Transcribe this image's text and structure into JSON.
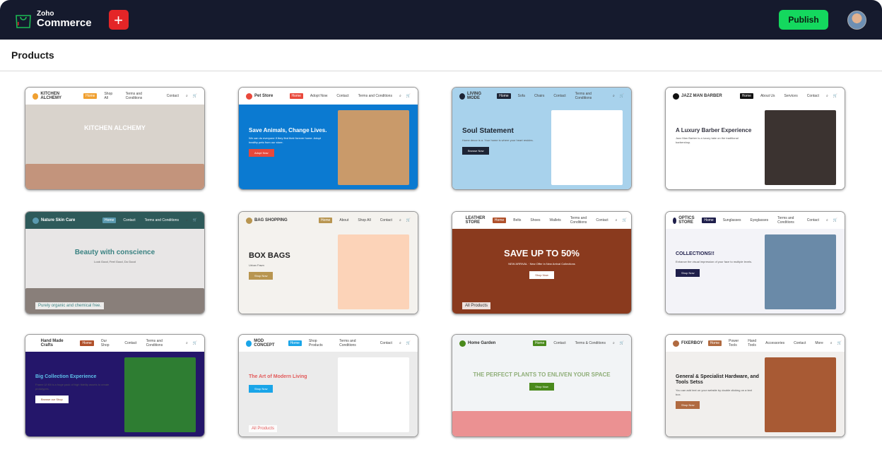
{
  "header": {
    "logo_small": "Zoho",
    "logo_large": "Commerce",
    "add_label": "+",
    "publish_label": "Publish"
  },
  "page_title": "Products",
  "colors": {
    "topbar": "#151a2d",
    "publish": "#14d85e",
    "add": "#e42527"
  },
  "templates": [
    {
      "name": "KITCHEN ALCHEMY",
      "nav": [
        "Home",
        "Shop All",
        "Terms and Conditions",
        "Contact"
      ],
      "headline": "KITCHEN ALCHEMY",
      "sub": "",
      "button": "",
      "header_bg": "#ffffff",
      "hero_bg": "#d9d3cc",
      "hl_color": "#ffffff",
      "accent": "#f0a030",
      "hl_size": 9,
      "center": true,
      "pic": "#b0603a"
    },
    {
      "name": "Pet Store",
      "nav": [
        "Home",
        "Adopt Now",
        "Contact",
        "Terms and Conditions"
      ],
      "headline": "Save Animals, Change Lives.",
      "sub": "We can do everyone if they find their forever home. Adopt healthy pets from our store.",
      "button": "Adopt Now",
      "header_bg": "#ffffff",
      "hero_bg": "#0b7ad1",
      "hl_color": "#ffffff",
      "accent": "#e9483b",
      "hl_size": 8,
      "pic": "#c99a6a"
    },
    {
      "name": "LIVING MODE",
      "nav": [
        "Home",
        "Sofa",
        "Chairs",
        "Contact",
        "Terms and Conditions"
      ],
      "headline": "Soul Statement",
      "sub": "Home decor is a. Your home is where your heart resides.",
      "button": "Browse Now",
      "header_bg": "#a8d2ec",
      "hero_bg": "#a8d2ec",
      "hl_color": "#1d2430",
      "accent": "#1d2435",
      "hl_size": 10,
      "pic": "#ffffff"
    },
    {
      "name": "JAZZ MAN BARBER",
      "nav": [
        "Home",
        "About Us",
        "Services",
        "Contact"
      ],
      "headline": "A Luxury Barber Experience",
      "sub": "Jazz Man Barber is a luxury take on the traditional barbershop.",
      "button": "",
      "header_bg": "#ffffff",
      "hero_bg": "#ffffff",
      "hl_color": "#333340",
      "accent": "#111111",
      "hl_size": 8,
      "pic": "#3b3330"
    },
    {
      "name": "Nature Skin Care",
      "nav": [
        "Home",
        "Contact",
        "Terms and Conditions"
      ],
      "headline": "Beauty with conscience",
      "sub": "Look Good, Feel Good, Do Good",
      "button": "",
      "header_bg": "#2e5a5a",
      "hero_bg": "#e8e6e6",
      "hl_color": "#3a8282",
      "accent": "#5a9ab0",
      "hl_size": 10,
      "center": true,
      "pic": "#3a2a20",
      "extra": "Purely organic and chemical free."
    },
    {
      "name": "BAG SHOPPING",
      "nav": [
        "Home",
        "About",
        "Shop All",
        "Contact"
      ],
      "headline": "BOX BAGS",
      "sub": "Urban Fawn",
      "button": "Shop Now",
      "header_bg": "#f4f2ee",
      "hero_bg": "#f4f2ee",
      "hl_color": "#222222",
      "accent": "#b89550",
      "hl_size": 11,
      "pic": "#fcd3b8"
    },
    {
      "name": "LEATHER STORE",
      "nav": [
        "Home",
        "Belts",
        "Shoes",
        "Wallets",
        "Terms and Conditions",
        "Contact"
      ],
      "headline": "SAVE UP TO 50%",
      "sub": "NEW ARRIVAL · New Offer in New Arrival Collections",
      "button": "Shop Now",
      "header_bg": "#ffffff",
      "hero_bg": "#8a3a1e",
      "hl_color": "#ffffff",
      "accent": "#ffffff",
      "hl_size": 13,
      "center": true,
      "pic": "",
      "extra": "All Products"
    },
    {
      "name": "OPTICS STORE",
      "nav": [
        "Home",
        "Sunglasses",
        "Eyeglasses",
        "Terms and Conditions",
        "Contact"
      ],
      "headline": "COLLECTIONS!!",
      "sub": "Enhance the visual impression of your face to multiple levels.",
      "button": "Shop Now",
      "header_bg": "#ffffff",
      "hero_bg": "#f3f3f8",
      "hl_color": "#1e1e4a",
      "accent": "#1e1e4a",
      "hl_size": 7,
      "pic": "#6a8aa8"
    },
    {
      "name": "Hand Made Crafts",
      "nav": [
        "Home",
        "Our Shop",
        "Contact",
        "Terms and Conditions"
      ],
      "headline": "Big Collection Experience",
      "sub": "Frame UI Kit is a huge pack of high fidelity assets to create prototypes.",
      "button": "Browse our Shop",
      "header_bg": "#ffffff",
      "hero_bg": "#24166a",
      "hl_color": "#5ec0ea",
      "accent": "#ffffff",
      "hl_size": 7,
      "pic": "#2e7d32"
    },
    {
      "name": "MOD CONCEPT",
      "nav": [
        "Home",
        "Shop Products",
        "Terms and Conditions",
        "Contact"
      ],
      "headline": "The Art of Modern Living",
      "sub": "",
      "button": "Shop Now",
      "header_bg": "#ffffff",
      "hero_bg": "#ebebeb",
      "hl_color": "#e25a5a",
      "accent": "#1aa5e8",
      "hl_size": 7,
      "pic": "#ffffff",
      "extra": "All Products"
    },
    {
      "name": "Home Garden",
      "nav": [
        "Home",
        "Contact",
        "Terms & Conditions"
      ],
      "headline": "THE PERFECT PLANTS TO ENLIVEN YOUR SPACE",
      "sub": "",
      "button": "Shop Now",
      "header_bg": "#f2f4f6",
      "hero_bg": "#f2f4f6",
      "hl_color": "#8fae78",
      "accent": "#4a8a1c",
      "hl_size": 8,
      "center": true,
      "pic": "#e54040"
    },
    {
      "name": "FIXERBOY",
      "nav": [
        "Home",
        "Power Tools",
        "Hand Tools",
        "Accessories",
        "Contact",
        "More"
      ],
      "headline": "General & Specialist Hardware, and Tools Setss",
      "sub": "You can add text on your website by double clicking on a text box.",
      "button": "Shop Now",
      "header_bg": "#ffffff",
      "hero_bg": "#f1efed",
      "hl_color": "#222222",
      "accent": "#b06a40",
      "hl_size": 7,
      "pic": "#a85a34"
    }
  ]
}
